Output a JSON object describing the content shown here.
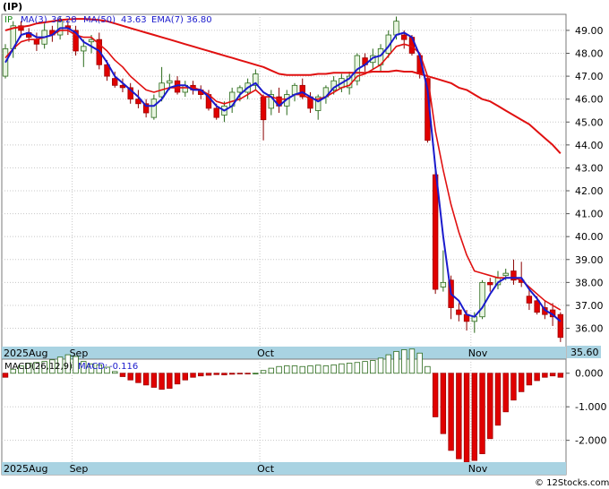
{
  "title": "(IP)",
  "watermark": "© 12Stocks.com",
  "colors": {
    "up_body": "#e8f5e0",
    "up_edge": "#2a6a1a",
    "down_fill": "#e00000",
    "ma3": "#1a1acc",
    "ma50": "#e01010",
    "macd_pos_edge": "#2a6a1a",
    "macd_neg": "#e00000",
    "axis_band": "#a9d3e2",
    "last_label_bg": "#a9d3e2"
  },
  "chart_data": [
    {
      "type": "candlestick",
      "panel": "price",
      "ylim": [
        35.2,
        49.7
      ],
      "y_ticks": [
        "36.00",
        "37.00",
        "38.00",
        "39.00",
        "40.00",
        "41.00",
        "42.00",
        "43.00",
        "44.00",
        "45.00",
        "46.00",
        "47.00",
        "48.00",
        "49.00"
      ],
      "x_labels": [
        "2025Aug",
        "Sep",
        "Oct",
        "Nov"
      ],
      "x_label_bar": [
        0,
        9,
        33,
        60
      ],
      "last_value_label": "35.60",
      "legend": [
        {
          "key": "ticker",
          "label": "IP"
        },
        {
          "key": "ma3",
          "label": "MA(3)",
          "value": "36.28"
        },
        {
          "key": "ma50",
          "label": "MA(50)",
          "value": "43.63"
        },
        {
          "key": "ema7",
          "label": "EMA(7)",
          "value": "36.80"
        }
      ],
      "candles": [
        [
          47.0,
          48.4,
          46.9,
          48.2
        ],
        [
          48.2,
          49.4,
          47.8,
          49.2
        ],
        [
          49.2,
          49.4,
          48.7,
          49.0
        ],
        [
          48.9,
          49.1,
          48.5,
          48.7
        ],
        [
          48.6,
          48.9,
          48.1,
          48.4
        ],
        [
          48.4,
          49.3,
          48.2,
          49.0
        ],
        [
          49.0,
          49.2,
          48.5,
          48.8
        ],
        [
          48.8,
          49.6,
          48.6,
          49.4
        ],
        [
          49.2,
          49.4,
          48.8,
          49.1
        ],
        [
          49.0,
          49.2,
          47.9,
          48.1
        ],
        [
          48.1,
          48.6,
          47.4,
          48.3
        ],
        [
          48.5,
          48.8,
          48.0,
          48.6
        ],
        [
          48.6,
          48.9,
          47.3,
          47.5
        ],
        [
          47.5,
          47.7,
          46.8,
          47.0
        ],
        [
          46.9,
          47.2,
          46.5,
          46.6
        ],
        [
          46.6,
          46.9,
          46.3,
          46.5
        ],
        [
          46.5,
          46.7,
          45.8,
          46.0
        ],
        [
          46.0,
          46.4,
          45.6,
          45.8
        ],
        [
          45.8,
          46.0,
          45.2,
          45.4
        ],
        [
          45.2,
          46.2,
          45.1,
          46.0
        ],
        [
          46.1,
          47.4,
          45.9,
          46.7
        ],
        [
          46.7,
          47.1,
          46.4,
          46.8
        ],
        [
          46.8,
          47.0,
          46.2,
          46.3
        ],
        [
          46.3,
          46.8,
          46.1,
          46.6
        ],
        [
          46.6,
          46.8,
          46.2,
          46.4
        ],
        [
          46.4,
          46.6,
          46.0,
          46.2
        ],
        [
          46.2,
          46.4,
          45.5,
          45.6
        ],
        [
          45.6,
          45.8,
          45.1,
          45.2
        ],
        [
          45.3,
          45.9,
          45.0,
          45.7
        ],
        [
          45.7,
          46.5,
          45.4,
          46.3
        ],
        [
          46.3,
          46.6,
          45.9,
          46.5
        ],
        [
          46.3,
          46.9,
          46.0,
          46.7
        ],
        [
          46.6,
          47.3,
          46.4,
          47.1
        ],
        [
          46.1,
          46.2,
          44.2,
          45.1
        ],
        [
          45.6,
          46.4,
          45.3,
          46.2
        ],
        [
          46.1,
          46.5,
          45.4,
          45.7
        ],
        [
          45.7,
          46.4,
          45.3,
          46.2
        ],
        [
          46.2,
          46.7,
          45.9,
          46.6
        ],
        [
          46.6,
          46.9,
          46.0,
          46.1
        ],
        [
          46.1,
          46.3,
          45.4,
          45.6
        ],
        [
          45.5,
          46.2,
          45.1,
          46.1
        ],
        [
          46.1,
          46.6,
          45.8,
          46.5
        ],
        [
          46.4,
          47.0,
          46.2,
          46.8
        ],
        [
          46.5,
          47.1,
          46.3,
          46.9
        ],
        [
          46.5,
          47.2,
          46.2,
          47.0
        ],
        [
          46.8,
          48.0,
          46.6,
          47.9
        ],
        [
          47.8,
          48.0,
          47.2,
          47.5
        ],
        [
          47.6,
          48.2,
          47.3,
          47.9
        ],
        [
          47.5,
          48.4,
          47.2,
          48.2
        ],
        [
          48.0,
          49.0,
          47.8,
          48.8
        ],
        [
          48.8,
          49.6,
          48.6,
          49.4
        ],
        [
          48.8,
          49.0,
          48.2,
          48.6
        ],
        [
          48.7,
          48.8,
          47.9,
          48.0
        ],
        [
          47.9,
          48.0,
          46.9,
          47.1
        ],
        [
          46.9,
          47.0,
          44.1,
          44.2
        ],
        [
          42.7,
          42.9,
          37.5,
          37.7
        ],
        [
          37.8,
          39.4,
          37.6,
          38.0
        ],
        [
          38.1,
          38.3,
          36.4,
          36.9
        ],
        [
          36.8,
          37.1,
          36.3,
          36.6
        ],
        [
          36.6,
          36.8,
          35.9,
          36.3
        ],
        [
          36.3,
          36.7,
          35.8,
          36.5
        ],
        [
          36.5,
          38.1,
          36.4,
          38.0
        ],
        [
          38.0,
          38.2,
          37.6,
          37.9
        ],
        [
          37.9,
          38.5,
          37.7,
          38.2
        ],
        [
          38.3,
          38.6,
          38.1,
          38.4
        ],
        [
          38.5,
          39.0,
          37.9,
          38.1
        ],
        [
          38.1,
          38.9,
          37.8,
          38.0
        ],
        [
          37.4,
          37.7,
          36.8,
          37.1
        ],
        [
          37.2,
          37.4,
          36.6,
          36.7
        ],
        [
          36.9,
          37.2,
          36.4,
          36.6
        ],
        [
          36.8,
          37.1,
          36.1,
          36.5
        ],
        [
          36.6,
          36.7,
          35.4,
          35.6
        ]
      ],
      "ma3": [
        47.6,
        48.2,
        48.8,
        48.9,
        48.7,
        48.7,
        48.8,
        49.1,
        49.1,
        48.9,
        48.5,
        48.3,
        48.1,
        47.6,
        47.0,
        46.7,
        46.4,
        46.1,
        45.7,
        45.7,
        46.0,
        46.5,
        46.6,
        46.6,
        46.4,
        46.4,
        46.1,
        45.7,
        45.5,
        45.7,
        46.2,
        46.5,
        46.7,
        46.3,
        46.1,
        45.7,
        46.0,
        46.2,
        46.3,
        46.1,
        45.9,
        46.1,
        46.5,
        46.7,
        46.9,
        47.3,
        47.5,
        47.8,
        47.9,
        48.3,
        48.8,
        48.9,
        48.7,
        47.9,
        46.4,
        43.0,
        40.0,
        37.5,
        37.2,
        36.6,
        36.5,
        36.9,
        37.5,
        38.0,
        38.2,
        38.2,
        38.2,
        37.7,
        37.3,
        36.8,
        36.6,
        36.3
      ],
      "ema7": [
        47.8,
        48.2,
        48.5,
        48.6,
        48.6,
        48.7,
        48.8,
        49.0,
        49.0,
        48.8,
        48.7,
        48.7,
        48.4,
        48.1,
        47.7,
        47.4,
        47.0,
        46.7,
        46.4,
        46.3,
        46.4,
        46.5,
        46.5,
        46.5,
        46.5,
        46.4,
        46.2,
        45.9,
        45.8,
        45.9,
        46.0,
        46.2,
        46.4,
        46.1,
        46.1,
        46.0,
        46.0,
        46.2,
        46.2,
        46.0,
        46.0,
        46.1,
        46.3,
        46.5,
        46.6,
        47.0,
        47.1,
        47.3,
        47.5,
        47.9,
        48.3,
        48.4,
        48.3,
        48.0,
        47.0,
        44.6,
        42.9,
        41.4,
        40.2,
        39.2,
        38.5,
        38.4,
        38.3,
        38.2,
        38.2,
        38.2,
        38.1,
        37.8,
        37.5,
        37.2,
        37.0,
        36.8
      ],
      "ma50": [
        49.0,
        49.1,
        49.15,
        49.2,
        49.3,
        49.35,
        49.4,
        49.45,
        49.48,
        49.5,
        49.5,
        49.48,
        49.45,
        49.4,
        49.3,
        49.2,
        49.1,
        49.0,
        48.9,
        48.8,
        48.7,
        48.6,
        48.5,
        48.4,
        48.3,
        48.2,
        48.1,
        48.0,
        47.9,
        47.8,
        47.7,
        47.6,
        47.5,
        47.4,
        47.25,
        47.1,
        47.05,
        47.05,
        47.05,
        47.05,
        47.1,
        47.1,
        47.15,
        47.15,
        47.15,
        47.15,
        47.15,
        47.2,
        47.2,
        47.2,
        47.25,
        47.2,
        47.2,
        47.1,
        47.0,
        46.9,
        46.8,
        46.7,
        46.5,
        46.4,
        46.2,
        46.0,
        45.9,
        45.7,
        45.5,
        45.3,
        45.1,
        44.9,
        44.6,
        44.3,
        44.0,
        43.63
      ]
    },
    {
      "type": "bar",
      "panel": "macd",
      "ylim": [
        -2.65,
        0.42
      ],
      "y_ticks": [
        "0.000",
        "-1.000",
        "-2.000"
      ],
      "x_labels": [
        "2025Aug",
        "Sep",
        "Oct",
        "Nov"
      ],
      "x_label_bar": [
        0,
        9,
        33,
        60
      ],
      "legend": [
        {
          "key": "macd_params",
          "label": "MACD(26,12,9)"
        },
        {
          "key": "macd_value",
          "label": "MACD:",
          "value": "-0.116"
        }
      ],
      "values": [
        -0.12,
        0.12,
        0.22,
        0.3,
        0.32,
        0.35,
        0.4,
        0.48,
        0.55,
        0.5,
        0.35,
        0.28,
        0.25,
        0.18,
        0.05,
        -0.1,
        -0.2,
        -0.28,
        -0.35,
        -0.42,
        -0.48,
        -0.45,
        -0.32,
        -0.2,
        -0.12,
        -0.08,
        -0.06,
        -0.04,
        -0.05,
        -0.03,
        -0.02,
        -0.01,
        0.0,
        0.08,
        0.15,
        0.2,
        0.22,
        0.22,
        0.2,
        0.22,
        0.24,
        0.22,
        0.25,
        0.28,
        0.3,
        0.32,
        0.35,
        0.38,
        0.45,
        0.55,
        0.65,
        0.7,
        0.72,
        0.6,
        0.2,
        -1.3,
        -1.8,
        -2.3,
        -2.55,
        -2.65,
        -2.6,
        -2.4,
        -1.95,
        -1.55,
        -1.15,
        -0.8,
        -0.55,
        -0.35,
        -0.22,
        -0.12,
        -0.08,
        -0.12
      ]
    }
  ]
}
